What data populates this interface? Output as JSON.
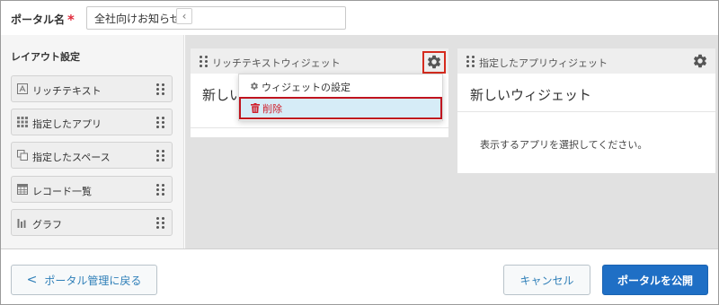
{
  "portal": {
    "name_label": "ポータル名",
    "required_mark": "*",
    "name_value": "全社向けお知らせ"
  },
  "sidebar": {
    "title": "レイアウト設定",
    "collapse_glyph": "‹",
    "items": [
      {
        "label": "リッチテキスト",
        "icon": "rich-text-icon"
      },
      {
        "label": "指定したアプリ",
        "icon": "app-grid-icon"
      },
      {
        "label": "指定したスペース",
        "icon": "space-icon"
      },
      {
        "label": "レコード一覧",
        "icon": "table-icon"
      },
      {
        "label": "グラフ",
        "icon": "bar-graph-icon"
      }
    ]
  },
  "widgets": [
    {
      "header_title": "リッチテキストウィジェット",
      "body_title": "新しいウィジェット",
      "body_text": ""
    },
    {
      "header_title": "指定したアプリウィジェット",
      "body_title": "新しいウィジェット",
      "body_text": "表示するアプリを選択してください。"
    }
  ],
  "dropdown": {
    "items": [
      {
        "label": "ウィジェットの設定",
        "icon": "gear-icon"
      },
      {
        "label": "削除",
        "icon": "trash-icon"
      }
    ]
  },
  "footer": {
    "back_label": "ポータル管理に戻る",
    "back_glyph": "<",
    "cancel_label": "キャンセル",
    "publish_label": "ポータルを公開"
  },
  "colors": {
    "accent": "#1f6fc5",
    "link": "#2f7fb8",
    "danger": "#d0202c",
    "highlight_border": "#c0141e",
    "selected_bg": "#d6ecf7"
  }
}
